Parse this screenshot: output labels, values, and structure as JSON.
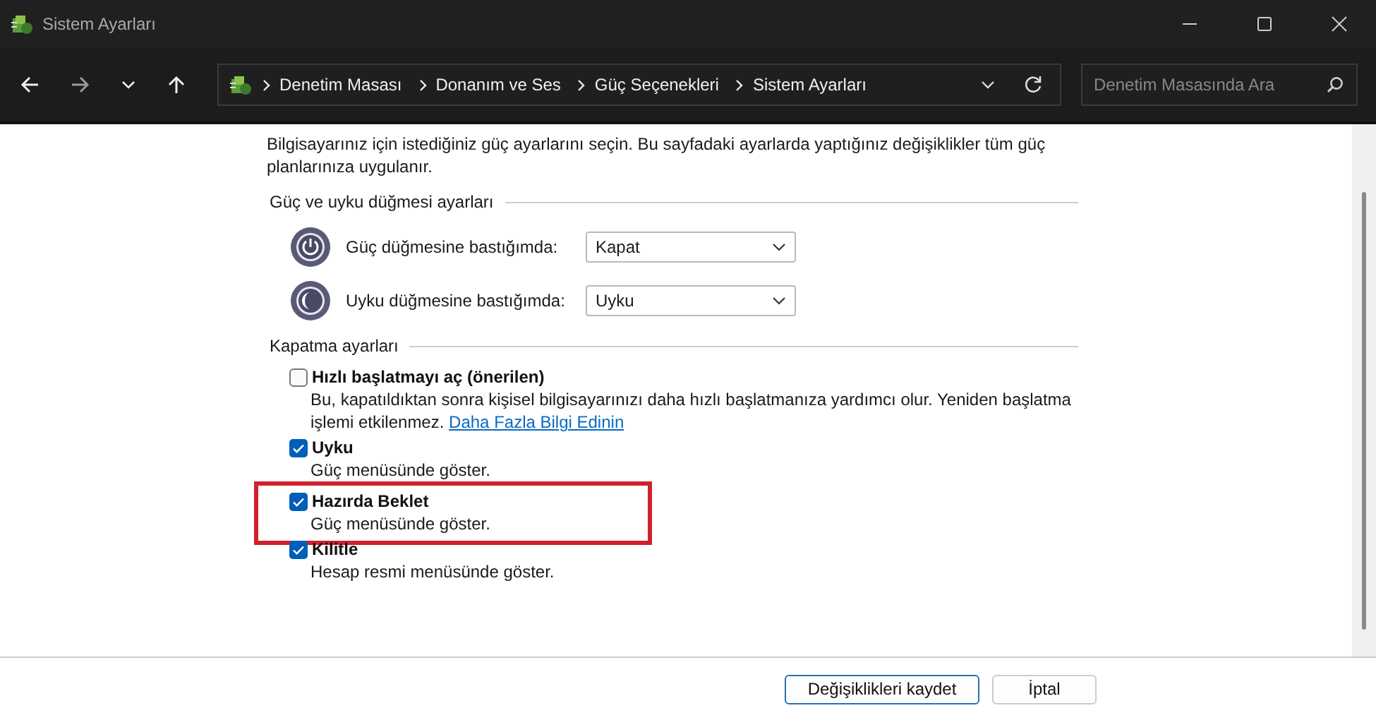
{
  "window": {
    "title": "Sistem Ayarları"
  },
  "breadcrumb": [
    "Denetim Masası",
    "Donanım ve Ses",
    "Güç Seçenekleri",
    "Sistem Ayarları"
  ],
  "search": {
    "placeholder": "Denetim Masasında Ara"
  },
  "intro": "Bilgisayarınız için istediğiniz güç ayarlarını seçin. Bu sayfadaki ayarlarda yaptığınız değişiklikler tüm güç planlarınıza uygulanır.",
  "button_section": {
    "title": "Güç ve uyku düğmesi ayarları",
    "rows": [
      {
        "kind": "power",
        "label": "Güç düğmesine bastığımda:",
        "value": "Kapat"
      },
      {
        "kind": "sleep",
        "label": "Uyku düğmesine bastığımda:",
        "value": "Uyku"
      }
    ]
  },
  "shutdown_section": {
    "title": "Kapatma ayarları",
    "options": [
      {
        "label": "Hızlı başlatmayı aç (önerilen)",
        "checked": false,
        "highlighted": false,
        "description": "Bu, kapatıldıktan sonra kişisel bilgisayarınızı daha hızlı başlatmanıza yardımcı olur. Yeniden başlatma işlemi etkilenmez.",
        "link": "Daha Fazla Bilgi Edinin"
      },
      {
        "label": "Uyku",
        "checked": true,
        "highlighted": false,
        "description": "Güç menüsünde göster."
      },
      {
        "label": "Hazırda Beklet",
        "checked": true,
        "highlighted": true,
        "description": "Güç menüsünde göster."
      },
      {
        "label": "Kilitle",
        "checked": true,
        "highlighted": false,
        "description": "Hesap resmi menüsünde göster."
      }
    ]
  },
  "buttons": [
    {
      "label": "Değişiklikleri kaydet",
      "selected": true
    },
    {
      "label": "İptal",
      "selected": false
    }
  ]
}
